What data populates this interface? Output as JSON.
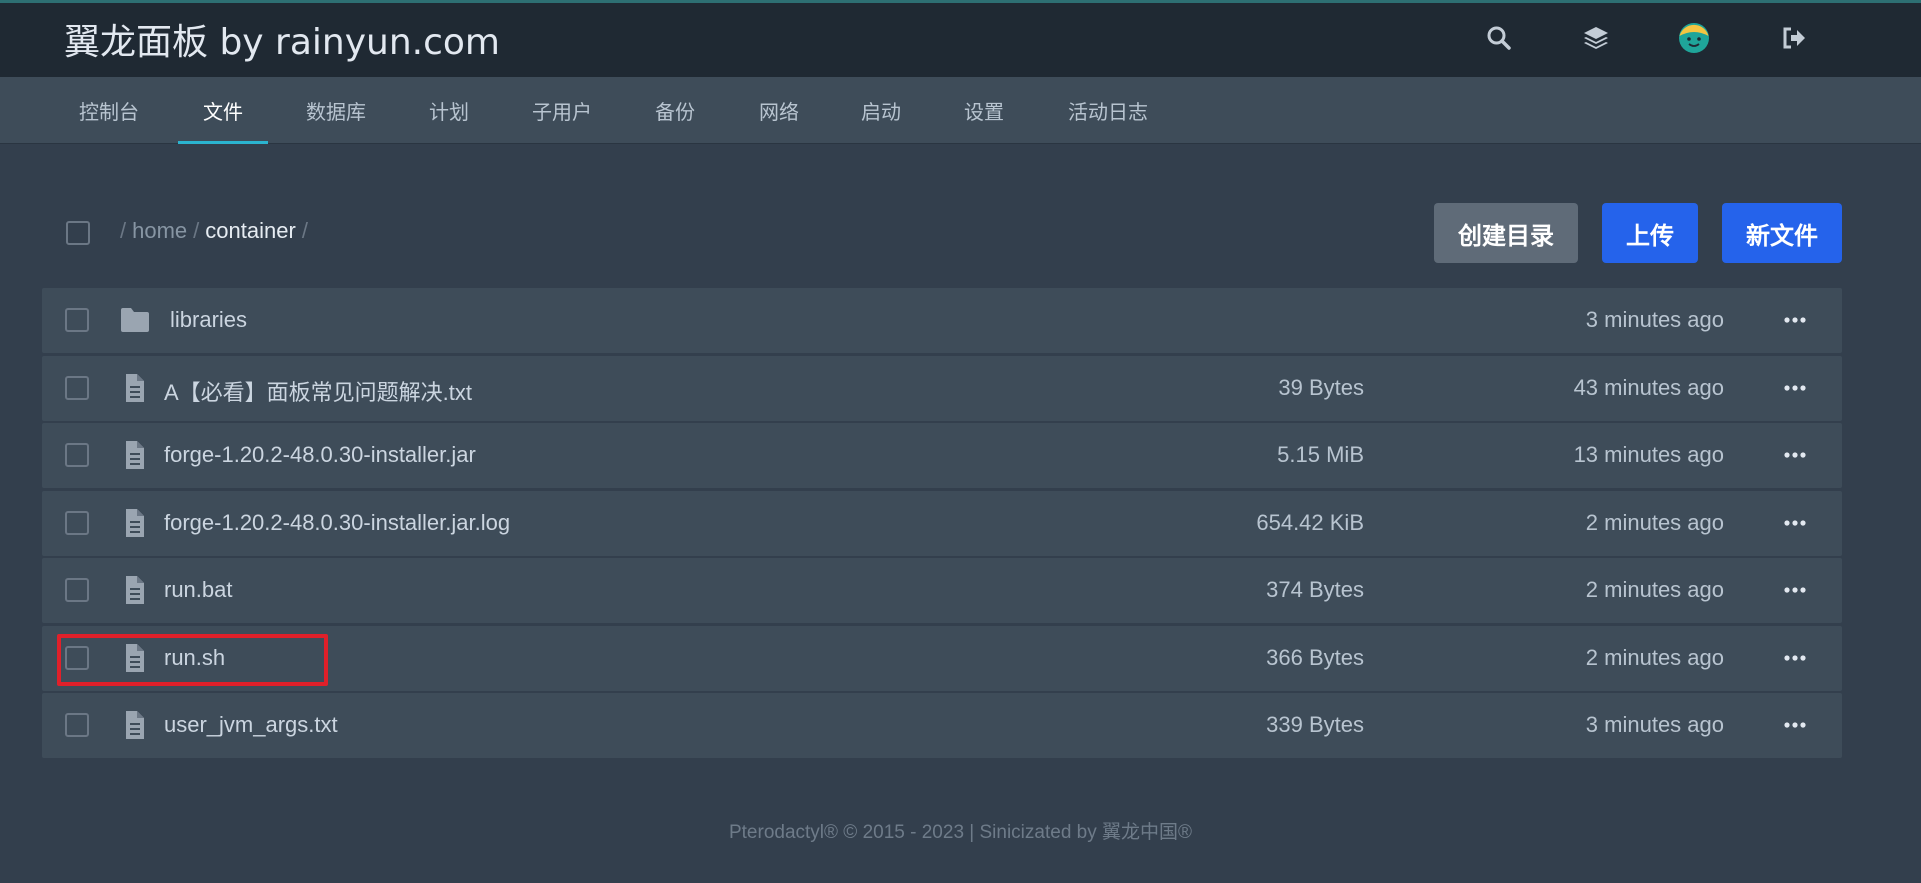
{
  "header": {
    "brand": "翼龙面板 by rainyun.com",
    "icons": [
      "search-icon",
      "layers-icon",
      "avatar",
      "logout-icon"
    ]
  },
  "nav": {
    "tabs": [
      {
        "label": "控制台",
        "active": false
      },
      {
        "label": "文件",
        "active": true
      },
      {
        "label": "数据库",
        "active": false
      },
      {
        "label": "计划",
        "active": false
      },
      {
        "label": "子用户",
        "active": false
      },
      {
        "label": "备份",
        "active": false
      },
      {
        "label": "网络",
        "active": false
      },
      {
        "label": "启动",
        "active": false
      },
      {
        "label": "设置",
        "active": false
      },
      {
        "label": "活动日志",
        "active": false
      }
    ]
  },
  "breadcrumb": {
    "separator": "/",
    "parts": [
      "home",
      "container"
    ]
  },
  "actions": {
    "create_dir": "创建目录",
    "upload": "上传",
    "new_file": "新文件"
  },
  "files": [
    {
      "name": "libraries",
      "type": "folder",
      "size": "",
      "modified": "3 minutes ago"
    },
    {
      "name": "A【必看】面板常见问题解决.txt",
      "type": "file",
      "size": "39 Bytes",
      "modified": "43 minutes ago"
    },
    {
      "name": "forge-1.20.2-48.0.30-installer.jar",
      "type": "file",
      "size": "5.15 MiB",
      "modified": "13 minutes ago"
    },
    {
      "name": "forge-1.20.2-48.0.30-installer.jar.log",
      "type": "file",
      "size": "654.42 KiB",
      "modified": "2 minutes ago"
    },
    {
      "name": "run.bat",
      "type": "file",
      "size": "374 Bytes",
      "modified": "2 minutes ago"
    },
    {
      "name": "run.sh",
      "type": "file",
      "size": "366 Bytes",
      "modified": "2 minutes ago",
      "highlighted": true
    },
    {
      "name": "user_jvm_args.txt",
      "type": "file",
      "size": "339 Bytes",
      "modified": "3 minutes ago"
    }
  ],
  "footer": {
    "text": "Pterodactyl® © 2015 - 2023 | Sinicizated by 翼龙中国®"
  },
  "colors": {
    "accent": "#2bb4d0",
    "primary_button": "#2563eb",
    "highlight": "#e0202a"
  }
}
